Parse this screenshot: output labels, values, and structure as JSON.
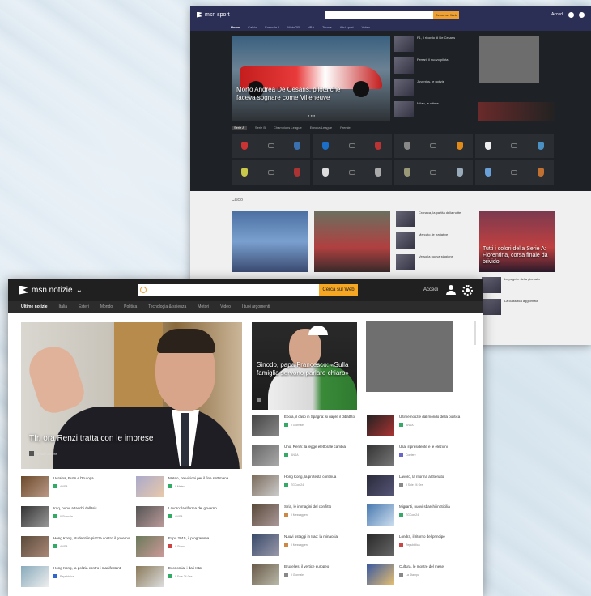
{
  "back_window": {
    "brand": "msn sport",
    "search_button": "Cerca nel Web",
    "user_label": "Accedi",
    "nav": [
      "Home",
      "Calcio",
      "Formula 1",
      "MotoGP",
      "NBA",
      "Tennis",
      "Altri sport",
      "Video"
    ],
    "hero_caption": "Morto Andrea De Cesaris, pilota che faceva sognare come Villeneuve",
    "side_list": [
      "F1, il ricordo di De Cesaris",
      "Ferrari, il nuovo pilota",
      "Juventus, le notizie",
      "Milan, le ultime",
      "Inter, il mercato"
    ],
    "tabs": [
      "Serie A",
      "Serie B",
      "Champions League",
      "Europa League",
      "Premier"
    ],
    "section_label": "Calcio",
    "pic1_caption": "",
    "pic2_caption": "",
    "pic3_caption": "Tutti i colori della Serie A: Fiorentina, corsa finale da brivido",
    "small_list": [
      "Cronaca, la partita della notte",
      "Mercato, le trattative",
      "Verso la nuova stagione",
      "Le pagelle della giornata",
      "La classifica aggiornata"
    ]
  },
  "front_window": {
    "brand": "msn notizie",
    "search_placeholder": "",
    "search_button": "Cerca sul Web",
    "user_label": "Accedi",
    "nav": [
      "Ultime notizie",
      "Italia",
      "Esteri",
      "Mondo",
      "Politica",
      "Tecnologia & scienza",
      "Motori",
      "Video",
      "I tuoi argomenti"
    ],
    "hero_caption": "Tfr, ora Renzi tratta con le imprese",
    "hero_meta": "Il Sole 24 Ore",
    "hero2_caption": "Sinodo, papa Francesco: «Sulla famiglia servono parlare chiaro»",
    "col_right_a": [
      {
        "title": "Ebola, il caso in Spagna: si riapre il dibattito",
        "source": "Il Giornale"
      },
      {
        "title": "Uno, Renzi: la legge elettorale cambia",
        "source": "ANSA"
      },
      {
        "title": "Hong Kong, la protesta continua",
        "source": "TGCom24"
      },
      {
        "title": "Siria, le immagini del conflitto",
        "source": "Il Messaggero"
      },
      {
        "title": "Nuovi ostaggi in Iraq: la minaccia",
        "source": "Il Messaggero"
      },
      {
        "title": "Bruxelles, il vertice europeo",
        "source": "Il Giornale"
      }
    ],
    "col_right_b": [
      {
        "title": "Ultime notizie dal mondo della politica",
        "source": "ANSA"
      },
      {
        "title": "Usa, il presidente e le elezioni",
        "source": "Corriere"
      },
      {
        "title": "Lavoro, la riforma al Senato",
        "source": "Il Sole 24 Ore"
      },
      {
        "title": "Migranti, nuovi sbarchi in Sicilia",
        "source": "TGCom24"
      },
      {
        "title": "Londra, il ritorno del principe",
        "source": "Repubblica"
      },
      {
        "title": "Cultura, le mostre del mese",
        "source": "La Stampa"
      }
    ],
    "col_left_a": [
      {
        "title": "Ucraina, Putin e l'Europa",
        "source": "ANSA"
      },
      {
        "title": "Iraq, nuovi attacchi dell'Isis",
        "source": "Il Giornale"
      },
      {
        "title": "Hong Kong, studenti in piazza contro il governo",
        "source": "ANSA"
      },
      {
        "title": "Hong Kong, la polizia contro i manifestanti",
        "source": "Repubblica"
      }
    ],
    "col_left_b": [
      {
        "title": "Meteo, previsioni per il fine settimana",
        "source": "Il Meteo"
      },
      {
        "title": "Lavoro: la riforma del governo",
        "source": "ANSA"
      },
      {
        "title": "Expo 2015, il programma",
        "source": "Il Giorno"
      },
      {
        "title": "Economia, i dati Istat",
        "source": "Il Sole 24 Ore"
      }
    ]
  }
}
